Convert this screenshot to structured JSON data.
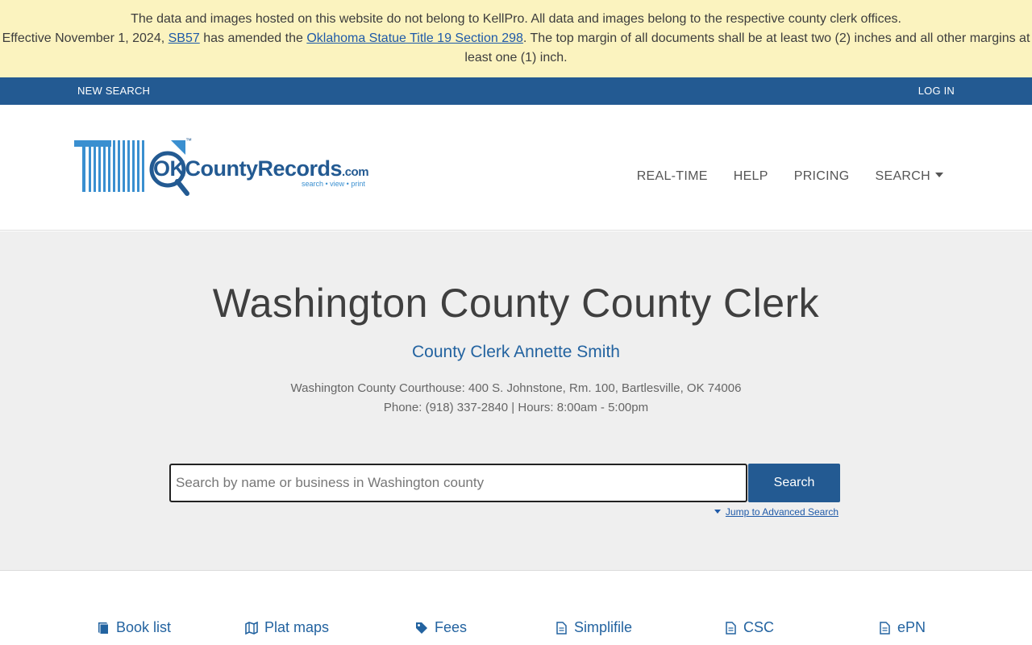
{
  "notice": {
    "line1": "The data and images hosted on this website do not belong to KellPro. All data and images belong to the respective county clerk offices.",
    "line2_pre": "Effective November 1, 2024, ",
    "line2_link1": "SB57",
    "line2_mid": " has amended the ",
    "line2_link2": "Oklahoma Statue Title 19 Section 298",
    "line2_post": ". The top margin of all documents shall be at least two (2) inches and all other margins at least one (1) inch."
  },
  "topbar": {
    "new_search": "NEW SEARCH",
    "login": "LOG IN"
  },
  "logo": {
    "word": "OKCountyRecords",
    "com": ".com",
    "tag": "search • view • print",
    "tm": "™"
  },
  "nav": {
    "realtime": "REAL-TIME",
    "help": "HELP",
    "pricing": "PRICING",
    "search": "SEARCH"
  },
  "hero": {
    "title": "Washington County County Clerk",
    "clerk": "County Clerk Annette Smith",
    "address": "Washington County Courthouse: 400 S. Johnstone, Rm. 100, Bartlesville, OK 74006",
    "contact": "Phone: (918) 337-2840 | Hours: 8:00am - 5:00pm"
  },
  "search": {
    "placeholder": "Search by name or business in Washington county",
    "value": "",
    "button": "Search",
    "advanced": "Jump to Advanced Search"
  },
  "links": {
    "book_list": "Book list",
    "plat_maps": "Plat maps",
    "fees": "Fees",
    "simplifile": "Simplifile",
    "csc": "CSC",
    "epn": "ePN"
  },
  "colors": {
    "brand": "#235a92",
    "notice_bg": "#fbf3bf",
    "link": "#2363a0"
  }
}
